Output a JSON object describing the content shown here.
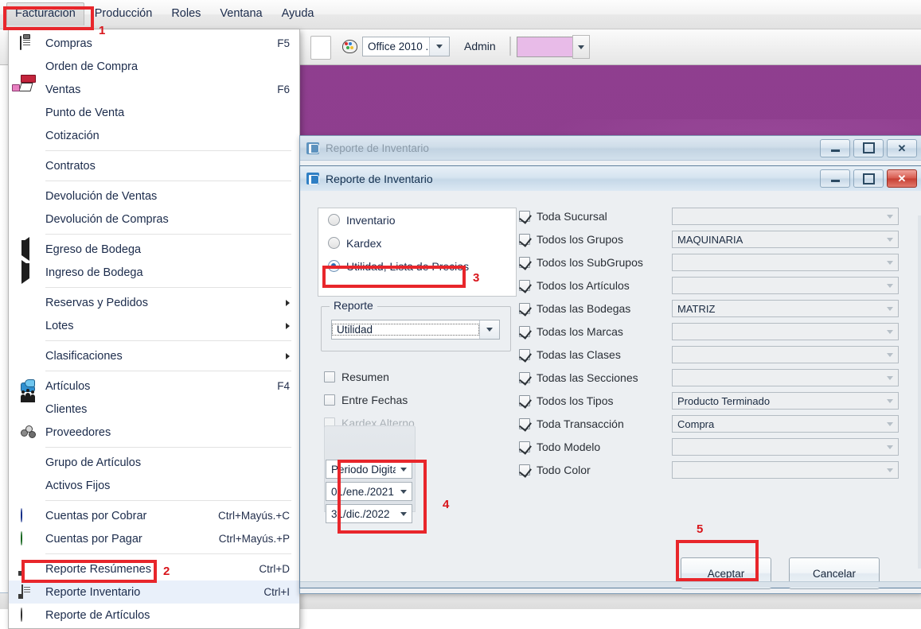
{
  "menubar": {
    "items": [
      {
        "label": "Facturación",
        "open": true
      },
      {
        "label": "Producción",
        "open": false
      },
      {
        "label": "Roles",
        "open": false
      },
      {
        "label": "Ventana",
        "open": false
      },
      {
        "label": "Ayuda",
        "open": false
      }
    ]
  },
  "toolbar": {
    "theme_value": "Office 2010 ...",
    "user": "Admin"
  },
  "dropdown": {
    "items": [
      {
        "label": "Compras",
        "accel": "F5",
        "icon": "clipboard-icon"
      },
      {
        "label": "Orden de Compra",
        "accel": "",
        "icon": ""
      },
      {
        "label": "Ventas",
        "accel": "F6",
        "icon": "sales-icon"
      },
      {
        "label": "Punto de Venta",
        "accel": "",
        "icon": ""
      },
      {
        "label": "Cotización",
        "accel": "",
        "icon": ""
      },
      {
        "label": "Contratos",
        "accel": "",
        "icon": ""
      },
      {
        "label": "Devolución de Ventas",
        "accel": "",
        "icon": ""
      },
      {
        "label": "Devolución de Compras",
        "accel": "",
        "icon": ""
      },
      {
        "label": "Egreso de Bodega",
        "accel": "",
        "icon": "arrow-left-icon"
      },
      {
        "label": "Ingreso de Bodega",
        "accel": "",
        "icon": "arrow-right-icon"
      },
      {
        "label": "Reservas y Pedidos",
        "accel": "",
        "icon": "",
        "submenu": true
      },
      {
        "label": "Lotes",
        "accel": "",
        "icon": "",
        "submenu": true
      },
      {
        "label": "Clasificaciones",
        "accel": "",
        "icon": "",
        "submenu": true
      },
      {
        "label": "Artículos",
        "accel": "F4",
        "icon": "articulos-icon"
      },
      {
        "label": "Clientes",
        "accel": "",
        "icon": "clientes-icon"
      },
      {
        "label": "Proveedores",
        "accel": "",
        "icon": "proveedores-icon"
      },
      {
        "label": "Grupo de Artículos",
        "accel": "",
        "icon": ""
      },
      {
        "label": "Activos Fijos",
        "accel": "",
        "icon": ""
      },
      {
        "label": "Cuentas por Cobrar",
        "accel": "Ctrl+Mayús.+C",
        "icon": "plus-circle-icon"
      },
      {
        "label": "Cuentas por Pagar",
        "accel": "Ctrl+Mayús.+P",
        "icon": "check-circle-icon"
      },
      {
        "label": "Reporte Resúmenes",
        "accel": "Ctrl+D",
        "icon": "document-icon"
      },
      {
        "label": "Reporte Inventario",
        "accel": "Ctrl+I",
        "icon": "document-lines-icon",
        "selected": true
      },
      {
        "label": "Reporte de Artículos",
        "accel": "",
        "icon": "pie-chart-icon"
      }
    ]
  },
  "mdi_window": {
    "title": "Reporte de Inventario"
  },
  "dialog": {
    "title": "Reporte de Inventario",
    "report_type": {
      "options": [
        {
          "label": "Inventario",
          "selected": false
        },
        {
          "label": "Kardex",
          "selected": false
        },
        {
          "label": "Utilidad, Lista de Precios",
          "selected": true
        }
      ]
    },
    "reporte_fieldset": {
      "legend": "Reporte",
      "value": "Utilidad"
    },
    "left_checks": [
      {
        "label": "Resumen",
        "checked": false,
        "enabled": true
      },
      {
        "label": "Entre Fechas",
        "checked": false,
        "enabled": true
      },
      {
        "label": "Kardex Alterno",
        "checked": false,
        "enabled": false
      }
    ],
    "date_panel": {
      "period": "Periodo Digitado",
      "date_from": "01/ene./2021",
      "date_to": "31/dic./2022"
    },
    "filters": [
      {
        "label": "Toda Sucursal",
        "checked": true,
        "value": ""
      },
      {
        "label": "Todos los Grupos",
        "checked": true,
        "value": "MAQUINARIA"
      },
      {
        "label": "Todos los SubGrupos",
        "checked": true,
        "value": ""
      },
      {
        "label": "Todos los Artículos",
        "checked": true,
        "value": ""
      },
      {
        "label": "Todas las Bodegas",
        "checked": true,
        "value": "MATRIZ"
      },
      {
        "label": "Todas los Marcas",
        "checked": true,
        "value": ""
      },
      {
        "label": "Todas las Clases",
        "checked": true,
        "value": ""
      },
      {
        "label": "Todas las Secciones",
        "checked": true,
        "value": ""
      },
      {
        "label": "Todos los Tipos",
        "checked": true,
        "value": "Producto Terminado"
      },
      {
        "label": "Toda Transacción",
        "checked": true,
        "value": "Compra"
      },
      {
        "label": "Todo Modelo",
        "checked": true,
        "value": ""
      },
      {
        "label": "Todo Color",
        "checked": true,
        "value": ""
      }
    ],
    "buttons": {
      "accept": "Aceptar",
      "cancel": "Cancelar"
    }
  },
  "annotations": {
    "steps": [
      "1",
      "2",
      "3",
      "4",
      "5"
    ],
    "color": "#d8151b"
  }
}
